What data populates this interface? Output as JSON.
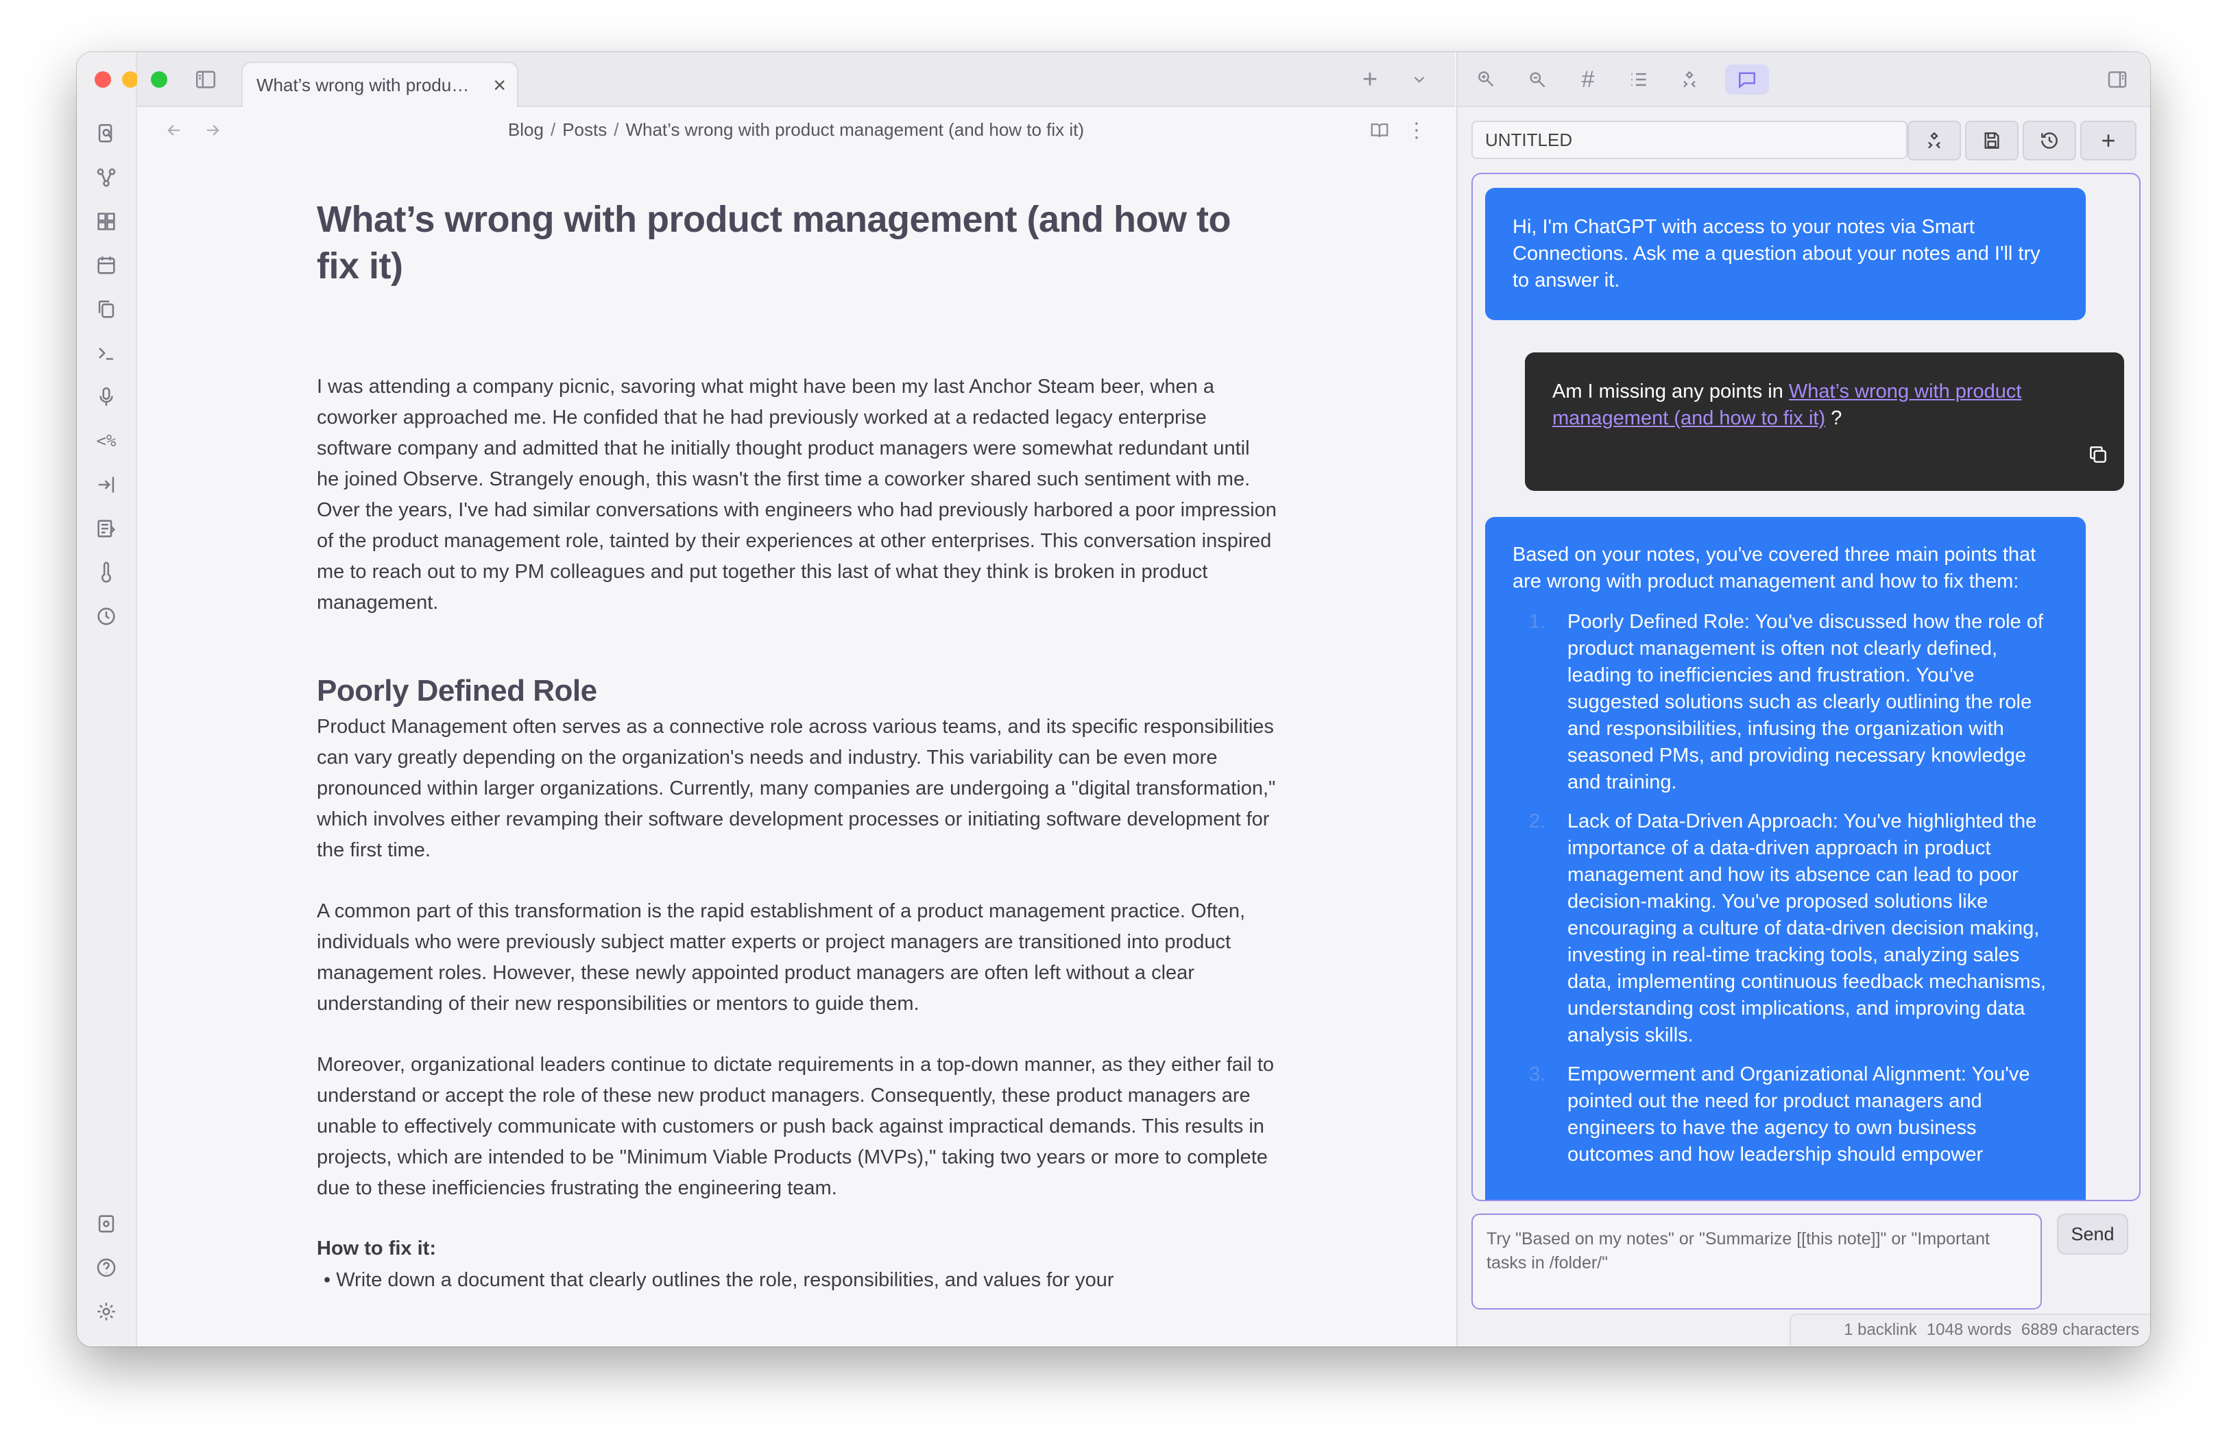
{
  "window": {
    "traffic_colors": {
      "close": "#fe5f57",
      "minimize": "#febc2e",
      "zoom": "#28c840"
    }
  },
  "ribbon": {
    "icons": [
      "search-icon",
      "graph-icon",
      "dashboard-icon",
      "calendar-icon",
      "copy-icon",
      "terminal-icon",
      "microphone-icon",
      "template-icon",
      "import-icon",
      "notes-icon",
      "thermometer-icon",
      "history-icon"
    ],
    "bottom_icons": [
      "vault-icon",
      "help-icon",
      "settings-icon"
    ]
  },
  "tab": {
    "title": "What’s wrong with produ…",
    "close": "×"
  },
  "breadcrumb": [
    "Blog",
    "Posts",
    "What’s wrong with product management (and how to fix it)"
  ],
  "breadcrumb_sep": "/",
  "document": {
    "title": "What’s wrong with product management (and how to fix it)",
    "intro": "I was attending a company picnic, savoring what might have been my last Anchor Steam beer, when a coworker approached me. He confided that he had previously worked at a redacted legacy enterprise software company and admitted that he initially thought product managers were somewhat redundant until he joined Observe. Strangely enough, this wasn't the first time a coworker shared such sentiment with me. Over the years, I've had similar conversations with engineers who had previously harbored a poor impression of the product management role, tainted by their experiences at other enterprises. This conversation inspired me to reach out to my PM colleagues and put together this last of what they think is broken in product management.",
    "h2": "Poorly Defined Role",
    "p1": "Product Management often serves as a connective role across various teams, and its specific responsibilities can vary greatly depending on the organization's needs and industry. This variability can be even more pronounced within larger organizations. Currently, many companies are undergoing a \"digital transformation,\" which involves either revamping their software development processes or initiating software development for the first time.",
    "p2": "A common part of this transformation is the rapid establishment of a product management practice. Often, individuals who were previously subject matter experts or project managers are transitioned into product management roles. However, these newly appointed product managers are often left without a clear understanding of their new responsibilities or mentors to guide them.",
    "p3": "Moreover, organizational leaders continue to dictate requirements in a top-down manner, as they either fail to understand or accept the role of these new product managers. Consequently, these product managers are unable to effectively communicate with customers or push back against impractical demands. This results in projects, which are intended to be \"Minimum Viable Products (MVPs),\" taking two years or more to complete due to these inefficiencies frustrating the engineering team.",
    "fix_label": "How to fix it:",
    "bullet": "• Write down a document that clearly outlines the role, responsibilities, and values for your"
  },
  "right_pane": {
    "tab_icons": [
      "smart-connections-icon",
      "smart-chat-icon",
      "tags-icon",
      "list-icon",
      "graph-icon",
      "chat-icon"
    ],
    "conversation_name": "UNTITLED",
    "messages": {
      "greeting": "Hi, I'm ChatGPT with access to your notes via Smart Connections. Ask me a question about your notes and I'll try to answer it.",
      "user_prefix": "Am I missing any points in ",
      "user_link": "What’s wrong with product management (and how to fix it)",
      "user_suffix": " ?",
      "answer_intro": "Based on your notes, you've covered three main points that are wrong with product management and how to fix them:",
      "points": [
        {
          "num": "1.",
          "text": "Poorly Defined Role: You've discussed how the role of product management is often not clearly defined, leading to inefficiencies and frustration. You've suggested solutions such as clearly outlining the role and responsibilities, infusing the organization with seasoned PMs, and providing necessary knowledge and training."
        },
        {
          "num": "2.",
          "text": "Lack of Data-Driven Approach: You've highlighted the importance of a data-driven approach in product management and how its absence can lead to poor decision-making. You've proposed solutions like encouraging a culture of data-driven decision making, investing in real-time tracking tools, analyzing sales data, implementing continuous feedback mechanisms, understanding cost implications, and improving data analysis skills."
        },
        {
          "num": "3.",
          "text": "Empowerment and Organizational Alignment: You've pointed out the need for product managers and engineers to have the agency to own business outcomes and how leadership should empower"
        }
      ]
    },
    "input_placeholder": "Try \"Based on my notes\" or \"Summarize [[this note]]\" or \"Important tasks in /folder/\"",
    "send_label": "Send"
  },
  "status_bar": {
    "backlinks": "1 backlink",
    "words": "1048 words",
    "characters": "6889 characters"
  },
  "colors": {
    "accent": "#7b6cf0",
    "bot_bubble": "#2f7bf5",
    "user_bubble": "#2c2c2c"
  }
}
